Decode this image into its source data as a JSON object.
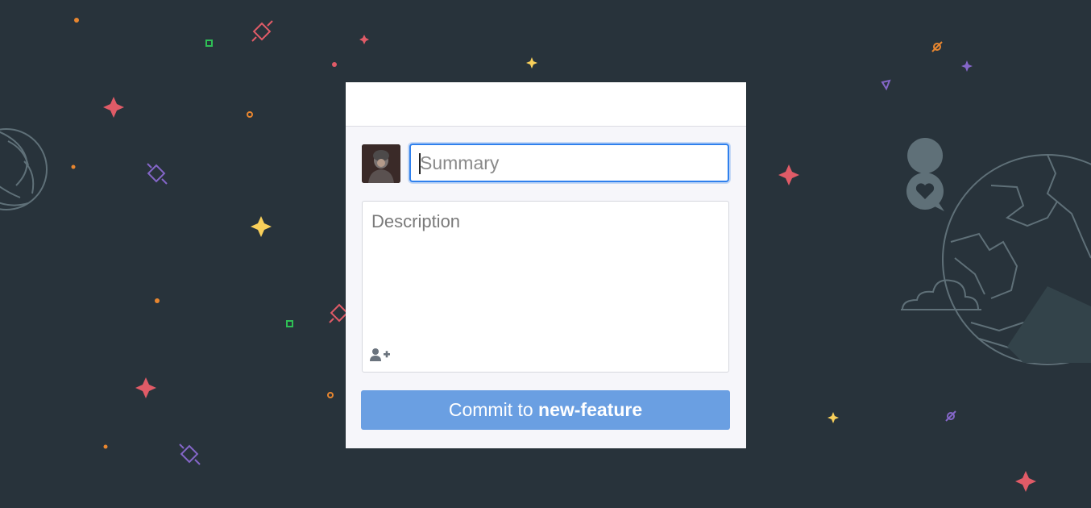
{
  "commit_form": {
    "summary_placeholder": "Summary",
    "summary_value": "",
    "description_placeholder": "Description",
    "description_value": "",
    "commit_prefix": "Commit to",
    "branch_name": "new-feature"
  },
  "icons": {
    "avatar": "user-avatar",
    "coauthor": "add-coauthor-icon",
    "speech_heart": "heart-speech-bubble-icon",
    "planet_left": "planet-icon",
    "globe_right": "globe-icon",
    "cloud": "cloud-icon"
  },
  "colors": {
    "background": "#28333b",
    "panel": "#f6f6fa",
    "focus_border": "#2f80ed",
    "commit_button": "#6a9fe2",
    "star_red": "#e05b67",
    "star_yellow": "#f9d05a",
    "star_green": "#2fbf55",
    "star_purple": "#8466c8",
    "star_orange": "#e8862f",
    "line_art": "#5f7078"
  }
}
